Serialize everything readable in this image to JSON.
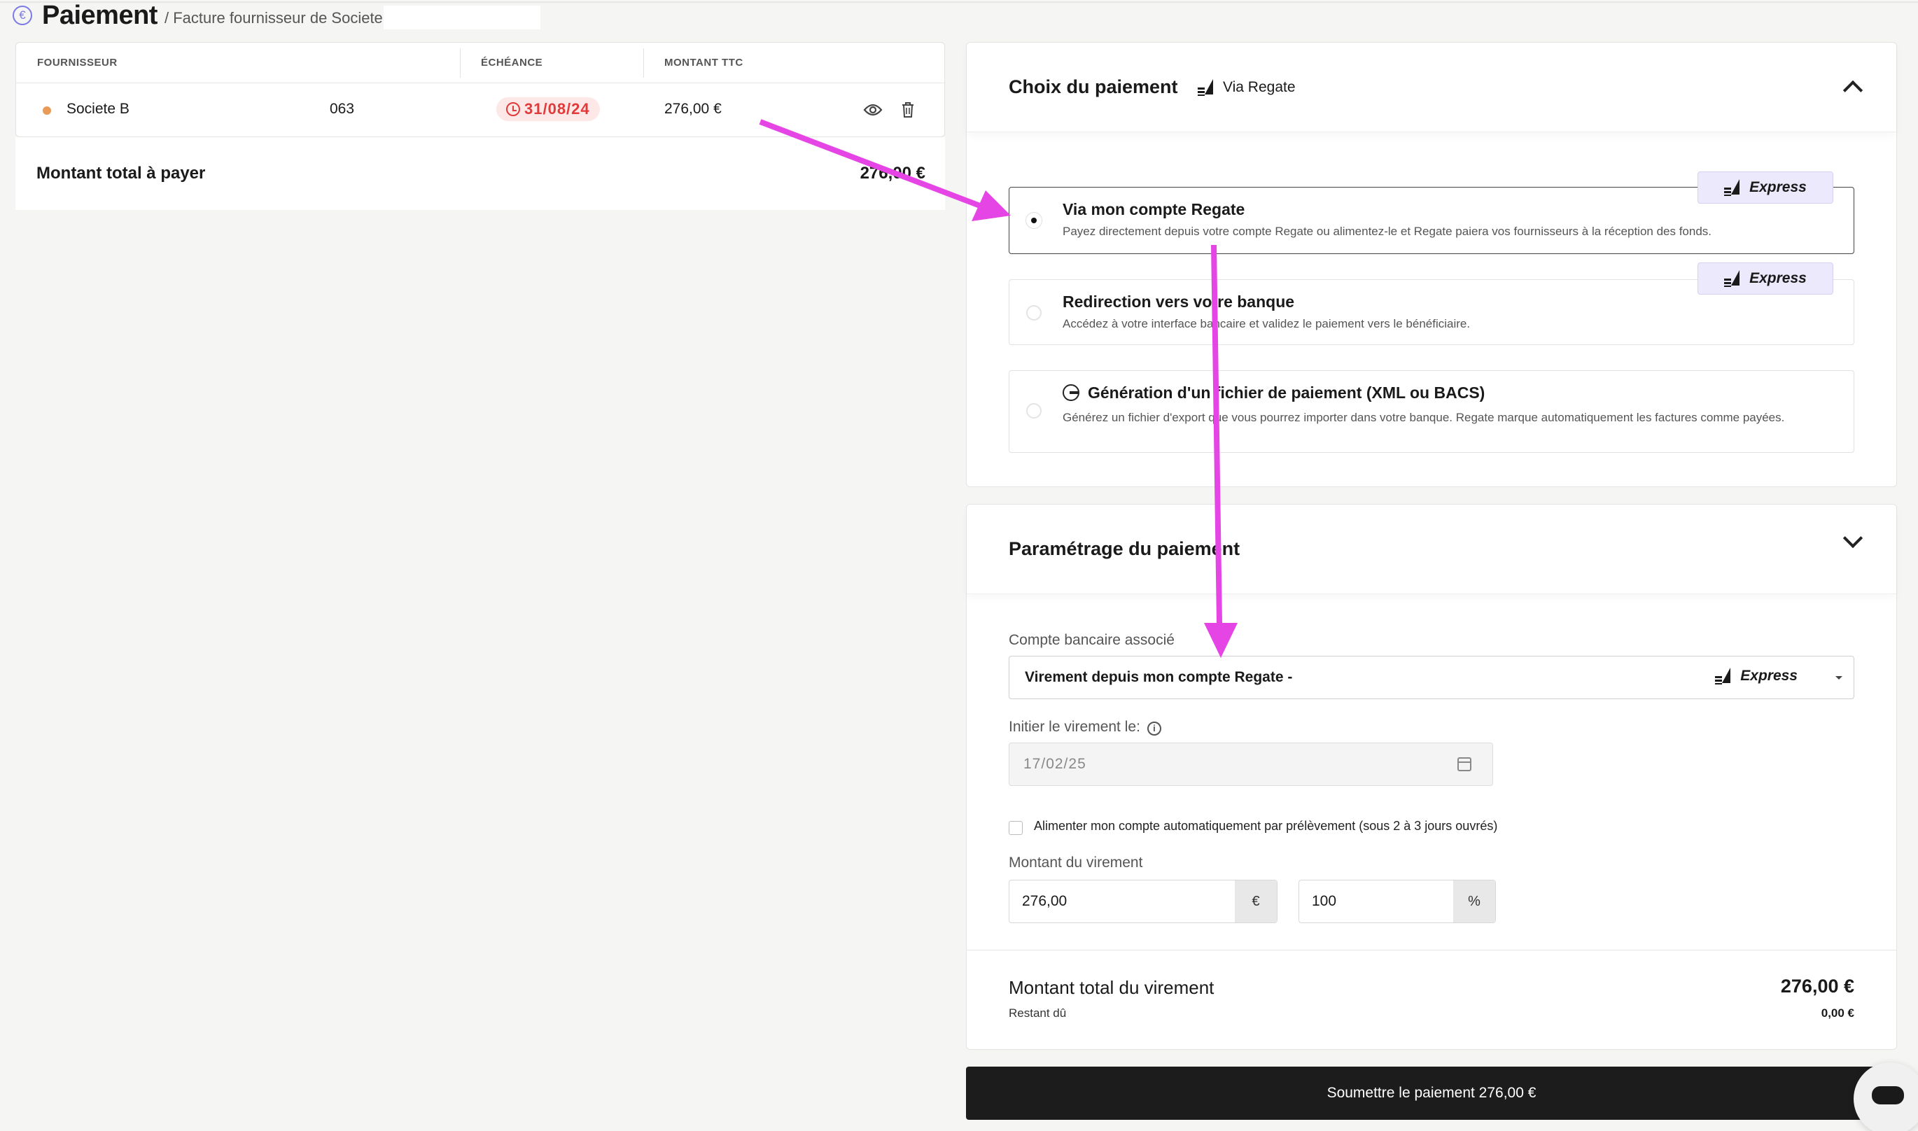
{
  "header": {
    "title": "Paiement",
    "breadcrumb": "/ Facture fournisseur de Societe B"
  },
  "invoice_table": {
    "columns": [
      "FOURNISSEUR",
      "ÉCHÉANCE",
      "MONTANT TTC"
    ],
    "row": {
      "supplier": "Societe B",
      "reference": "063",
      "due_date": "31/08/24",
      "amount": "276,00 €"
    },
    "total_label": "Montant total à payer",
    "total_value": "276,00 €"
  },
  "payment_choice": {
    "title": "Choix du paiement",
    "via": "Via Regate",
    "options": [
      {
        "title": "Via mon compte Regate",
        "desc": "Payez directement depuis votre compte Regate ou alimentez-le et Regate paiera vos fournisseurs à la réception des fonds.",
        "badge": "Express",
        "selected": true
      },
      {
        "title": "Redirection vers votre banque",
        "desc": "Accédez à votre interface bancaire et validez le paiement vers le bénéficiaire.",
        "badge": "Express",
        "selected": false
      },
      {
        "title": "Génération d'un fichier de paiement (XML ou BACS)",
        "desc": "Générez un fichier d'export que vous pourrez importer dans votre banque. Regate marque automatiquement les factures comme payées.",
        "selected": false
      }
    ]
  },
  "payment_settings": {
    "title": "Paramétrage du paiement",
    "account_label": "Compte bancaire associé",
    "account_value": "Virement depuis mon compte Regate -",
    "account_badge": "Express",
    "date_label": "Initier le virement le:",
    "date_value": "17/02/25",
    "auto_fund_label": "Alimenter mon compte automatiquement par prélèvement (sous 2 à 3 jours ouvrés)",
    "amount_label": "Montant du virement",
    "amount_value": "276,00",
    "amount_unit": "€",
    "percent_value": "100",
    "percent_unit": "%",
    "total_label": "Montant total du virement",
    "total_value": "276,00 €",
    "remaining_label": "Restant dû",
    "remaining_value": "0,00 €"
  },
  "submit_label": "Soumettre le paiement 276,00 €",
  "colors": {
    "accent_arrow": "#e545e5",
    "due_red": "#e03a3a",
    "express_bg": "#ebe9fb"
  },
  "icons": [
    "euro-icon",
    "clock-icon",
    "eye-icon",
    "trash-icon",
    "sail-icon",
    "chevron-up-icon",
    "chevron-down-icon",
    "file-export-icon",
    "info-icon",
    "calendar-icon",
    "chat-icon"
  ]
}
